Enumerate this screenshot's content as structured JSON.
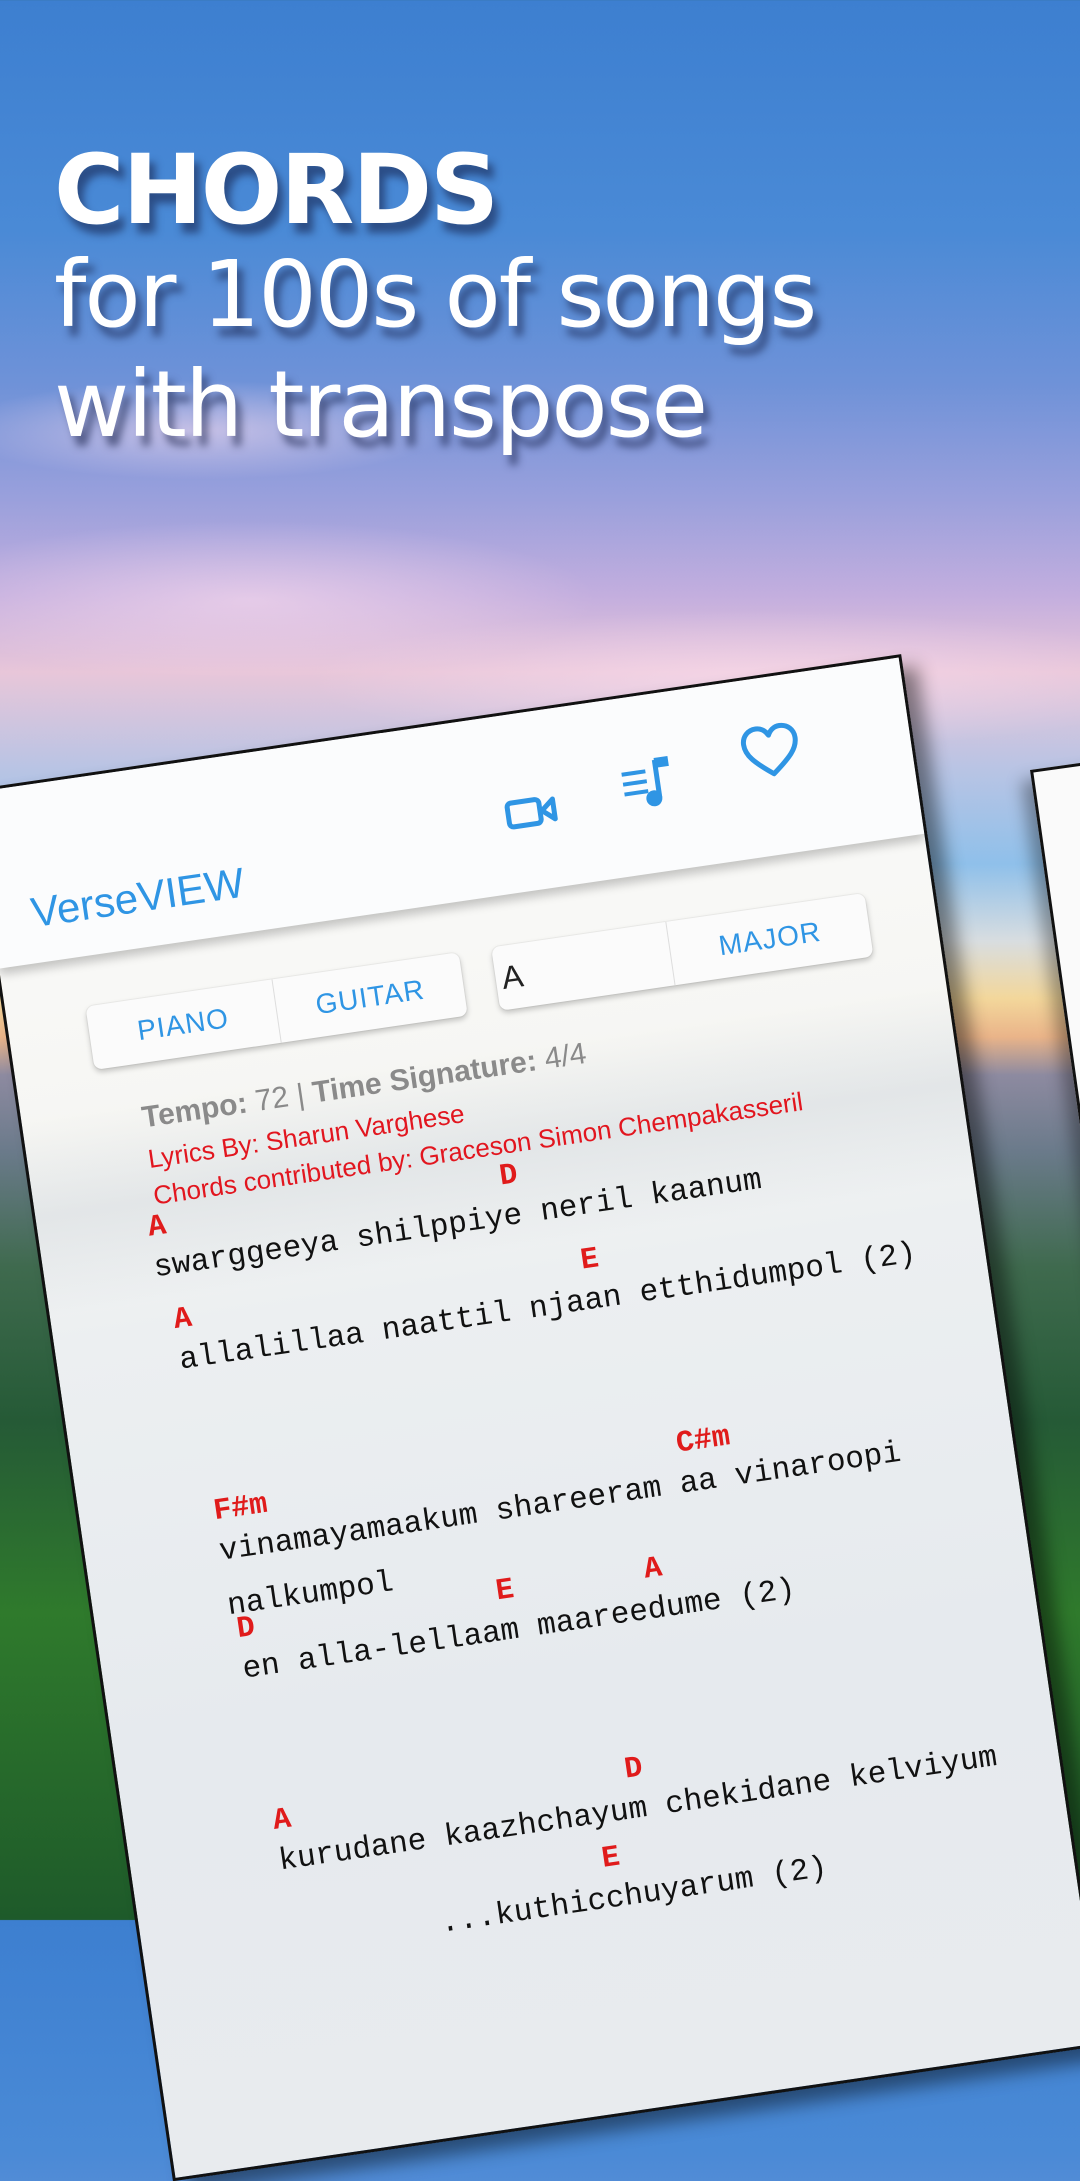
{
  "hero": {
    "headline": "CHORDS",
    "line2": "for 100s of songs",
    "line3": "with transpose"
  },
  "app": {
    "title": "VerseVIEW",
    "accent_color": "#2f95e4",
    "chord_color": "#e01b1b",
    "toolbar_icons": [
      "video-camera-icon",
      "music-playlist-icon",
      "heart-icon"
    ]
  },
  "controls": {
    "instrument_options": [
      "PIANO",
      "GUITAR"
    ],
    "key_value": "A",
    "scale_label": "MAJOR"
  },
  "song": {
    "tempo_label": "Tempo:",
    "tempo_value": "72",
    "separator": "|",
    "time_signature_label": "Time Signature:",
    "time_signature_value": "4/4",
    "lyrics_by": "Lyrics By: Sharun Varghese",
    "chords_by": "Chords contributed by: Graceson Simon Chempakasseril",
    "lines": [
      {
        "chords": [
          {
            "text": "A",
            "col": 0
          },
          {
            "text": "D",
            "col": 19
          }
        ],
        "lyric": "swarggeeya shilppiye neril kaanum"
      },
      {
        "chords": [
          {
            "text": "A",
            "col": 0
          },
          {
            "text": "E",
            "col": 22
          }
        ],
        "lyric": "allalillaa naattil njaan etthidumpol (2)"
      },
      {
        "chords": [
          {
            "text": "F#m",
            "col": 0
          },
          {
            "text": "C#m",
            "col": 25
          }
        ],
        "lyric": "vinamayamaakum shareeram aa vinaroopi"
      },
      {
        "chords": [],
        "lyric": "nalkumpol"
      },
      {
        "chords": [
          {
            "text": "D",
            "col": 0
          },
          {
            "text": "E",
            "col": 14
          },
          {
            "text": "A",
            "col": 22
          }
        ],
        "lyric": "en alla-lellaam maareedume (2)"
      },
      {
        "chords": [
          {
            "text": "A",
            "col": 0
          },
          {
            "text": "D",
            "col": 19
          }
        ],
        "lyric": "kurudane kaazhchayum chekidane kelviyum"
      },
      {
        "chords": [
          {
            "text": "E",
            "col": 17
          }
        ],
        "lyric": "        ...kuthicchuyarum (2)"
      }
    ]
  }
}
